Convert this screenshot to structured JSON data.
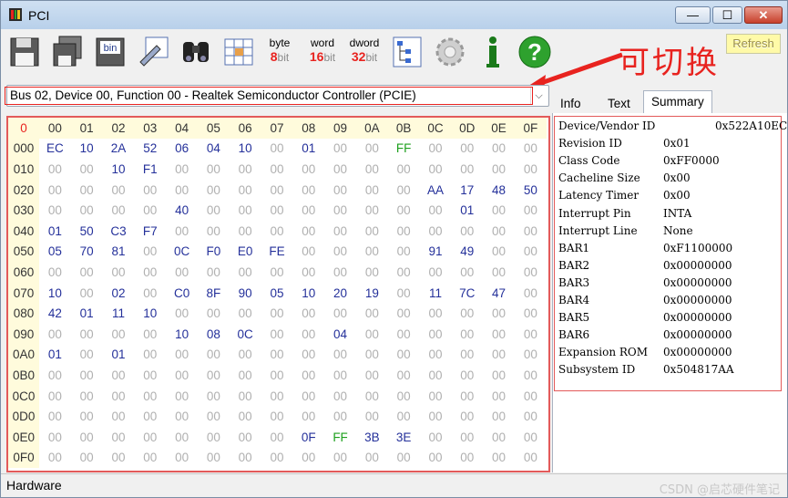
{
  "window": {
    "title": "PCI"
  },
  "toolbar": {
    "byte": {
      "top": "byte",
      "num": "8",
      "unit": "bit"
    },
    "word": {
      "top": "word",
      "num": "16",
      "unit": "bit"
    },
    "dword": {
      "top": "dword",
      "num": "32",
      "unit": "bit"
    },
    "refresh_label": "Refresh",
    "icons": [
      "save-icon",
      "save-all-icon",
      "save-bin-icon",
      "edit-icon",
      "binoculars-icon",
      "grid-icon",
      "tree-icon",
      "gear-icon",
      "info-icon",
      "help-icon"
    ],
    "numcolor_byte": "#e8231f",
    "numcolor_word": "#e8231f",
    "numcolor_dword": "#e8231f"
  },
  "annotation": {
    "text": "可切换",
    "color": "#e8231f"
  },
  "device_select": {
    "value": "Bus 02, Device 00, Function 00 - Realtek Semiconductor  Controller (PCIE)"
  },
  "hex": {
    "corner": "0",
    "columns": [
      "00",
      "01",
      "02",
      "03",
      "04",
      "05",
      "06",
      "07",
      "08",
      "09",
      "0A",
      "0B",
      "0C",
      "0D",
      "0E",
      "0F"
    ],
    "rows": [
      {
        "addr": "000",
        "cells": [
          "EC",
          "10",
          "2A",
          "52",
          "06",
          "04",
          "10",
          "00",
          "01",
          "00",
          "00",
          "FF",
          "00",
          "00",
          "00",
          "00"
        ]
      },
      {
        "addr": "010",
        "cells": [
          "00",
          "00",
          "10",
          "F1",
          "00",
          "00",
          "00",
          "00",
          "00",
          "00",
          "00",
          "00",
          "00",
          "00",
          "00",
          "00"
        ]
      },
      {
        "addr": "020",
        "cells": [
          "00",
          "00",
          "00",
          "00",
          "00",
          "00",
          "00",
          "00",
          "00",
          "00",
          "00",
          "00",
          "AA",
          "17",
          "48",
          "50"
        ]
      },
      {
        "addr": "030",
        "cells": [
          "00",
          "00",
          "00",
          "00",
          "40",
          "00",
          "00",
          "00",
          "00",
          "00",
          "00",
          "00",
          "00",
          "01",
          "00",
          "00"
        ]
      },
      {
        "addr": "040",
        "cells": [
          "01",
          "50",
          "C3",
          "F7",
          "00",
          "00",
          "00",
          "00",
          "00",
          "00",
          "00",
          "00",
          "00",
          "00",
          "00",
          "00"
        ]
      },
      {
        "addr": "050",
        "cells": [
          "05",
          "70",
          "81",
          "00",
          "0C",
          "F0",
          "E0",
          "FE",
          "00",
          "00",
          "00",
          "00",
          "91",
          "49",
          "00",
          "00"
        ]
      },
      {
        "addr": "060",
        "cells": [
          "00",
          "00",
          "00",
          "00",
          "00",
          "00",
          "00",
          "00",
          "00",
          "00",
          "00",
          "00",
          "00",
          "00",
          "00",
          "00"
        ]
      },
      {
        "addr": "070",
        "cells": [
          "10",
          "00",
          "02",
          "00",
          "C0",
          "8F",
          "90",
          "05",
          "10",
          "20",
          "19",
          "00",
          "11",
          "7C",
          "47",
          "00"
        ]
      },
      {
        "addr": "080",
        "cells": [
          "42",
          "01",
          "11",
          "10",
          "00",
          "00",
          "00",
          "00",
          "00",
          "00",
          "00",
          "00",
          "00",
          "00",
          "00",
          "00"
        ]
      },
      {
        "addr": "090",
        "cells": [
          "00",
          "00",
          "00",
          "00",
          "10",
          "08",
          "0C",
          "00",
          "00",
          "04",
          "00",
          "00",
          "00",
          "00",
          "00",
          "00"
        ]
      },
      {
        "addr": "0A0",
        "cells": [
          "01",
          "00",
          "01",
          "00",
          "00",
          "00",
          "00",
          "00",
          "00",
          "00",
          "00",
          "00",
          "00",
          "00",
          "00",
          "00"
        ]
      },
      {
        "addr": "0B0",
        "cells": [
          "00",
          "00",
          "00",
          "00",
          "00",
          "00",
          "00",
          "00",
          "00",
          "00",
          "00",
          "00",
          "00",
          "00",
          "00",
          "00"
        ]
      },
      {
        "addr": "0C0",
        "cells": [
          "00",
          "00",
          "00",
          "00",
          "00",
          "00",
          "00",
          "00",
          "00",
          "00",
          "00",
          "00",
          "00",
          "00",
          "00",
          "00"
        ]
      },
      {
        "addr": "0D0",
        "cells": [
          "00",
          "00",
          "00",
          "00",
          "00",
          "00",
          "00",
          "00",
          "00",
          "00",
          "00",
          "00",
          "00",
          "00",
          "00",
          "00"
        ]
      },
      {
        "addr": "0E0",
        "cells": [
          "00",
          "00",
          "00",
          "00",
          "00",
          "00",
          "00",
          "00",
          "0F",
          "FF",
          "3B",
          "3E",
          "00",
          "00",
          "00",
          "00"
        ]
      },
      {
        "addr": "0F0",
        "cells": [
          "00",
          "00",
          "00",
          "00",
          "00",
          "00",
          "00",
          "00",
          "00",
          "00",
          "00",
          "00",
          "00",
          "00",
          "00",
          "00"
        ]
      }
    ],
    "green_values": [
      "FF"
    ]
  },
  "tabs": [
    {
      "label": "Info"
    },
    {
      "label": "Text"
    },
    {
      "label": "Summary"
    }
  ],
  "summary": [
    {
      "label": "Device/Vendor ID",
      "value": "0x522A10EC"
    },
    {
      "label": "Revision ID",
      "value": "0x01"
    },
    {
      "label": "Class Code",
      "value": "0xFF0000"
    },
    {
      "label": "Cacheline Size",
      "value": "0x00"
    },
    {
      "label": "Latency Timer",
      "value": "0x00"
    },
    {
      "label": "Interrupt Pin",
      "value": "INTA"
    },
    {
      "label": "Interrupt Line",
      "value": "None"
    },
    {
      "label": "BAR1",
      "value": "0xF1100000"
    },
    {
      "label": "BAR2",
      "value": "0x00000000"
    },
    {
      "label": "BAR3",
      "value": "0x00000000"
    },
    {
      "label": "BAR4",
      "value": "0x00000000"
    },
    {
      "label": "BAR5",
      "value": "0x00000000"
    },
    {
      "label": "BAR6",
      "value": "0x00000000"
    },
    {
      "label": "Expansion ROM",
      "value": "0x00000000"
    },
    {
      "label": "Subsystem ID",
      "value": "0x504817AA"
    }
  ],
  "status": {
    "text": "Hardware"
  },
  "watermark": "CSDN @启芯硬件笔记"
}
